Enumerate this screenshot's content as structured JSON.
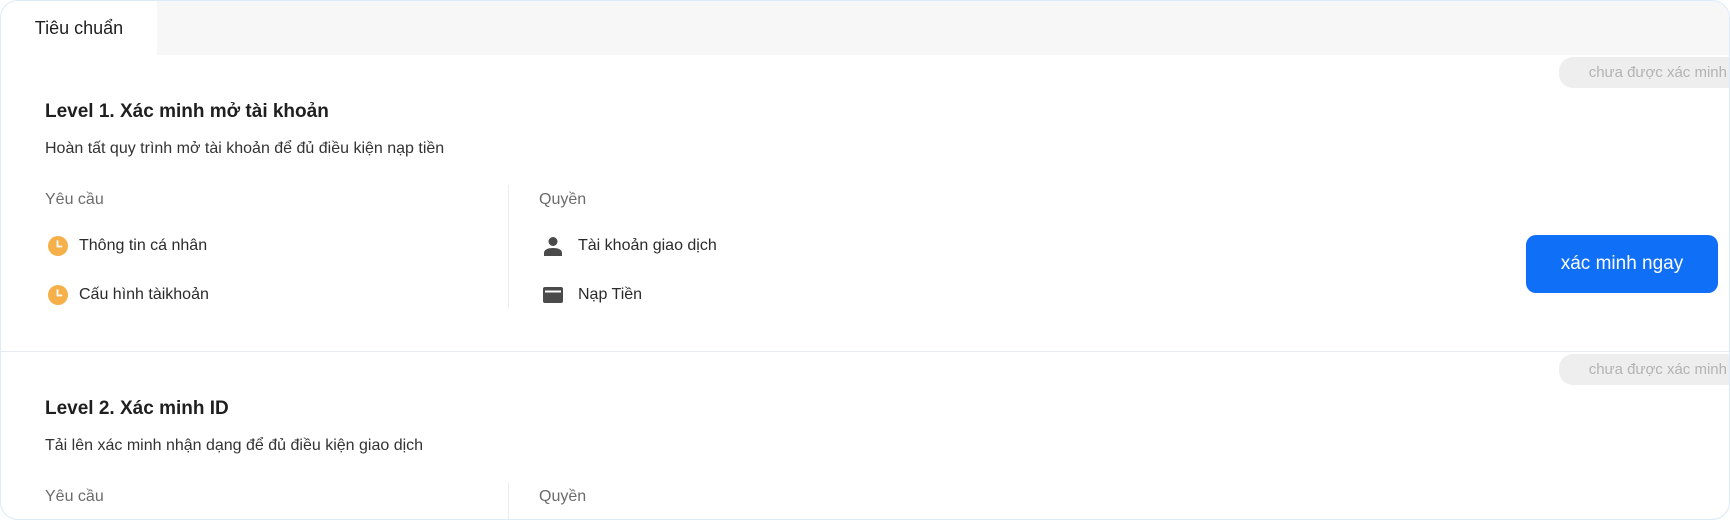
{
  "tabs": [
    {
      "label": "Tiêu chuẩn",
      "active": true
    }
  ],
  "levels": [
    {
      "status": "chưa được xác minh",
      "title": "Level 1. Xác minh mở tài khoản",
      "description": "Hoàn tất quy trình mở tài khoản để đủ điều kiện nạp tiền",
      "requirements_header": "Yêu cầu",
      "permissions_header": "Quyền",
      "requirements": [
        {
          "label": "Thông tin cá nhân",
          "icon": "clock-pending-icon"
        },
        {
          "label": "Cấu hình tàikhoản",
          "icon": "clock-pending-icon"
        }
      ],
      "permissions": [
        {
          "label": "Tài khoản giao dịch",
          "icon": "user-icon"
        },
        {
          "label": "Nạp Tiền",
          "icon": "card-icon"
        }
      ],
      "action_label": "xác minh ngay"
    },
    {
      "status": "chưa được xác minh",
      "title": "Level 2. Xác minh ID",
      "description": "Tải lên xác minh nhận dạng để đủ điều kiện giao dịch",
      "requirements_header": "Yêu cầu",
      "permissions_header": "Quyền"
    }
  ],
  "colors": {
    "accent": "#0f6ff7",
    "pending": "#f5b04a",
    "icon_dark": "#4a4a4a"
  }
}
